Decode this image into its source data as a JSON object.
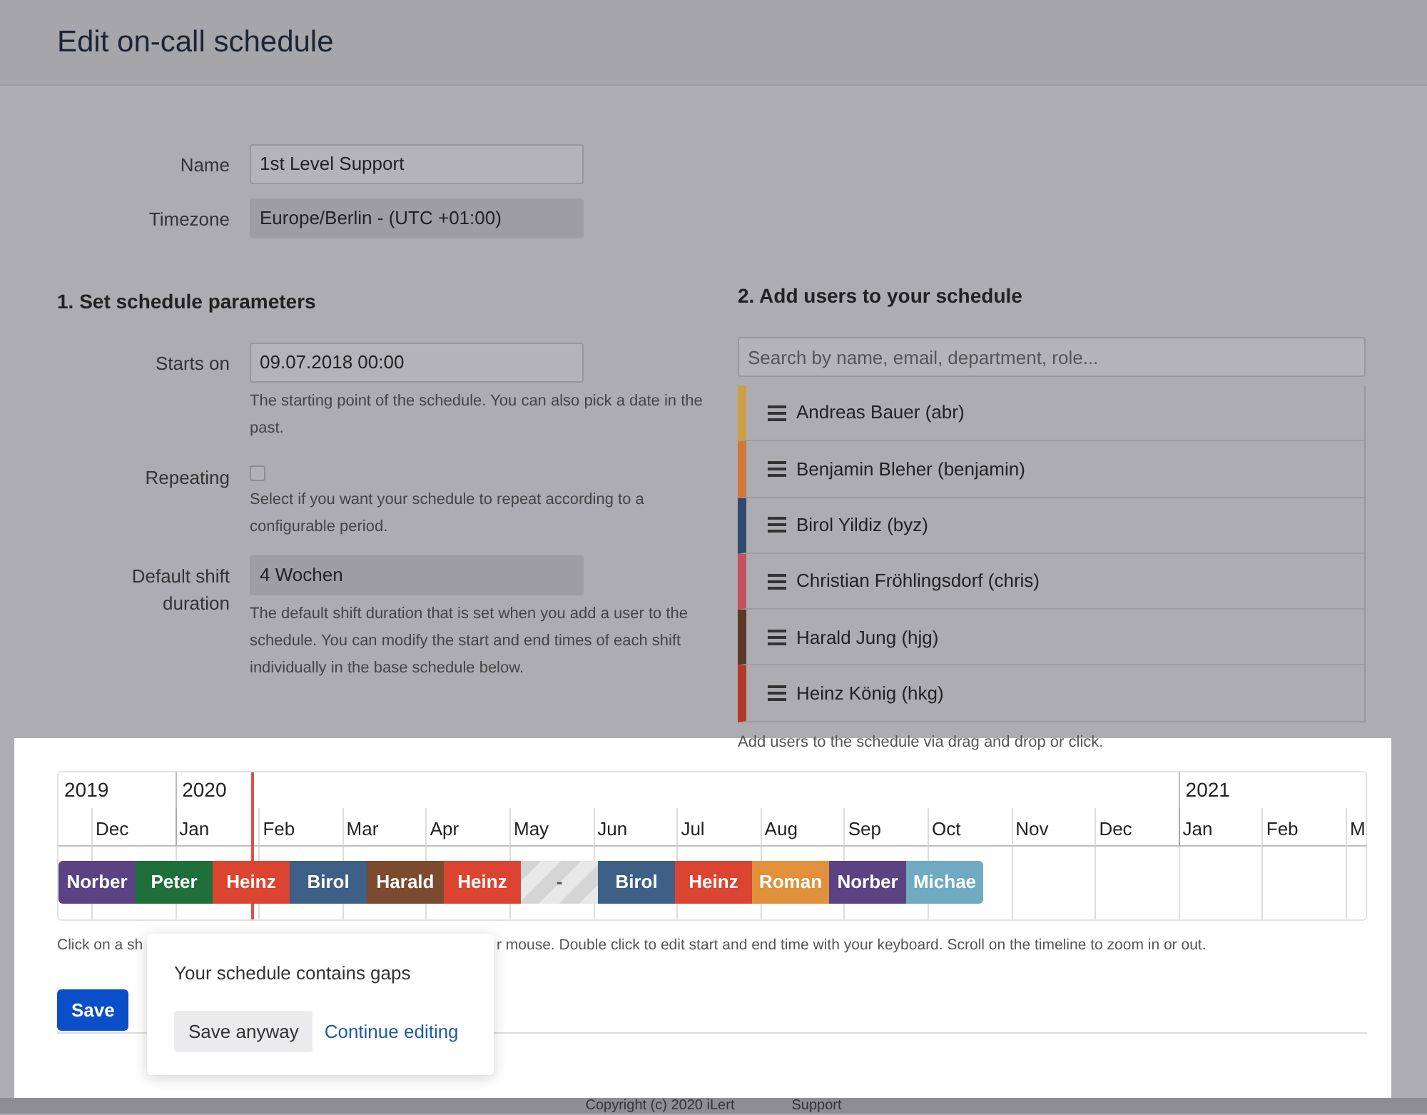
{
  "page": {
    "title": "Edit on-call schedule"
  },
  "general": [
    {
      "kind": "text",
      "label": "Name",
      "value": "1st Level Support"
    },
    {
      "kind": "select",
      "label": "Timezone",
      "value": "Europe/Berlin - (UTC +01:00)"
    }
  ],
  "parameters": {
    "heading": "1. Set schedule parameters",
    "fields": [
      {
        "kind": "text",
        "label": "Starts on",
        "value": "09.07.2018 00:00",
        "help": "The starting point of the schedule. You can also pick a date in the past."
      },
      {
        "kind": "checkbox",
        "label": "Repeating",
        "checked": false,
        "help": "Select if you want your schedule to repeat according to a configurable period."
      },
      {
        "kind": "select",
        "label": "Default shift duration",
        "value": "4 Wochen",
        "help": "The default shift duration that is set when you add a user to the schedule. You can modify the start and end times of each shift individually in the base schedule below."
      }
    ]
  },
  "users": {
    "heading": "2. Add users to your schedule",
    "search": {
      "placeholder": "Search by name, email, department, role..."
    },
    "items": [
      {
        "name": "Andreas Bauer (abr)",
        "color": "#cf9d45"
      },
      {
        "name": "Benjamin Bleher (benjamin)",
        "color": "#d27a35"
      },
      {
        "name": "Birol Yildiz (byz)",
        "color": "#2f4a6e"
      },
      {
        "name": "Christian Fröhlingsdorf (chris)",
        "color": "#c5505e"
      },
      {
        "name": "Harald Jung (hjg)",
        "color": "#5b3a2a"
      },
      {
        "name": "Heinz König (hkg)",
        "color": "#b3382a"
      }
    ],
    "hint": "Add users to the schedule via drag and drop or click."
  },
  "timeline": {
    "months": [
      {
        "year": "2019"
      },
      {
        "label": "Dec"
      },
      {
        "label": "Jan",
        "year": "2020"
      },
      {
        "label": "Feb"
      },
      {
        "label": "Mar"
      },
      {
        "label": "Apr"
      },
      {
        "label": "May"
      },
      {
        "label": "Jun"
      },
      {
        "label": "Jul"
      },
      {
        "label": "Aug"
      },
      {
        "label": "Sep"
      },
      {
        "label": "Oct"
      },
      {
        "label": "Nov"
      },
      {
        "label": "Dec"
      },
      {
        "label": "Jan",
        "year": "2021"
      },
      {
        "label": "Feb"
      },
      {
        "label": "M"
      }
    ],
    "shifts": [
      {
        "kind": "user",
        "name": "Norber",
        "color": "#5b4283"
      },
      {
        "kind": "user",
        "name": "Peter",
        "color": "#1f6f3b"
      },
      {
        "kind": "user",
        "name": "Heinz",
        "color": "#dc4432"
      },
      {
        "kind": "user",
        "name": "Birol",
        "color": "#3e5f86"
      },
      {
        "kind": "user",
        "name": "Harald",
        "color": "#7b4a2f"
      },
      {
        "kind": "user",
        "name": "Heinz",
        "color": "#dc4432"
      },
      {
        "kind": "gap",
        "name": "-"
      },
      {
        "kind": "user",
        "name": "Birol",
        "color": "#3e5f86"
      },
      {
        "kind": "user",
        "name": "Heinz",
        "color": "#dc4432"
      },
      {
        "kind": "user",
        "name": "Roman",
        "color": "#e0913a"
      },
      {
        "kind": "user",
        "name": "Norber",
        "color": "#5b4283"
      },
      {
        "kind": "user",
        "name": "Michae",
        "color": "#6fa9c2"
      }
    ],
    "hint_parts": [
      "Click on a sh",
      "r mouse. Double click to edit start and end time with your keyboard. Scroll on the timeline to zoom in or out."
    ]
  },
  "save_button": "Save",
  "popover": {
    "message": "Your schedule contains gaps",
    "actions": [
      {
        "kind": "secondary",
        "label": "Save anyway"
      },
      {
        "kind": "link",
        "label": "Continue editing"
      }
    ]
  },
  "footer": {
    "copyright": "Copyright (c) 2020 iLert",
    "link": "Support"
  }
}
